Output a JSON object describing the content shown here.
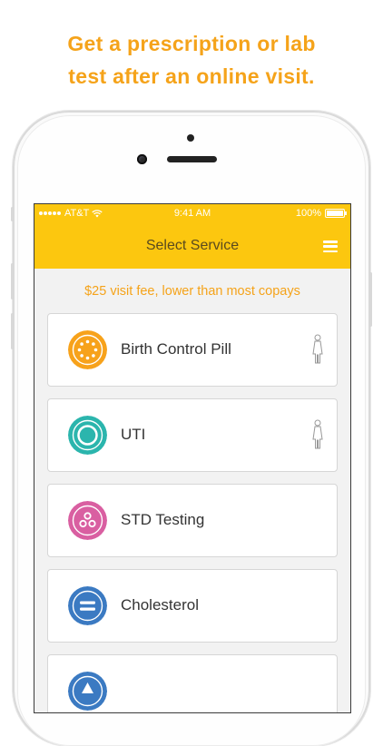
{
  "headline": {
    "line1": "Get a prescription or lab",
    "line2": "test after an online visit."
  },
  "status_bar": {
    "carrier": "AT&T",
    "time": "9:41 AM",
    "battery": "100%"
  },
  "nav": {
    "title": "Select Service"
  },
  "fee_notice": "$25 visit fee, lower than most copays",
  "services": [
    {
      "label": "Birth Control Pill",
      "icon": "pill-pack-icon",
      "color": "#f7a21b",
      "female_only": true
    },
    {
      "label": "UTI",
      "icon": "ring-icon",
      "color": "#2bb5ad",
      "female_only": true
    },
    {
      "label": "STD Testing",
      "icon": "three-dots-icon",
      "color": "#d95fa1",
      "female_only": false
    },
    {
      "label": "Cholesterol",
      "icon": "equals-icon",
      "color": "#3b7ac2",
      "female_only": false
    }
  ],
  "colors": {
    "accent": "#f5a31a",
    "nav_yellow": "#fcc70f"
  }
}
